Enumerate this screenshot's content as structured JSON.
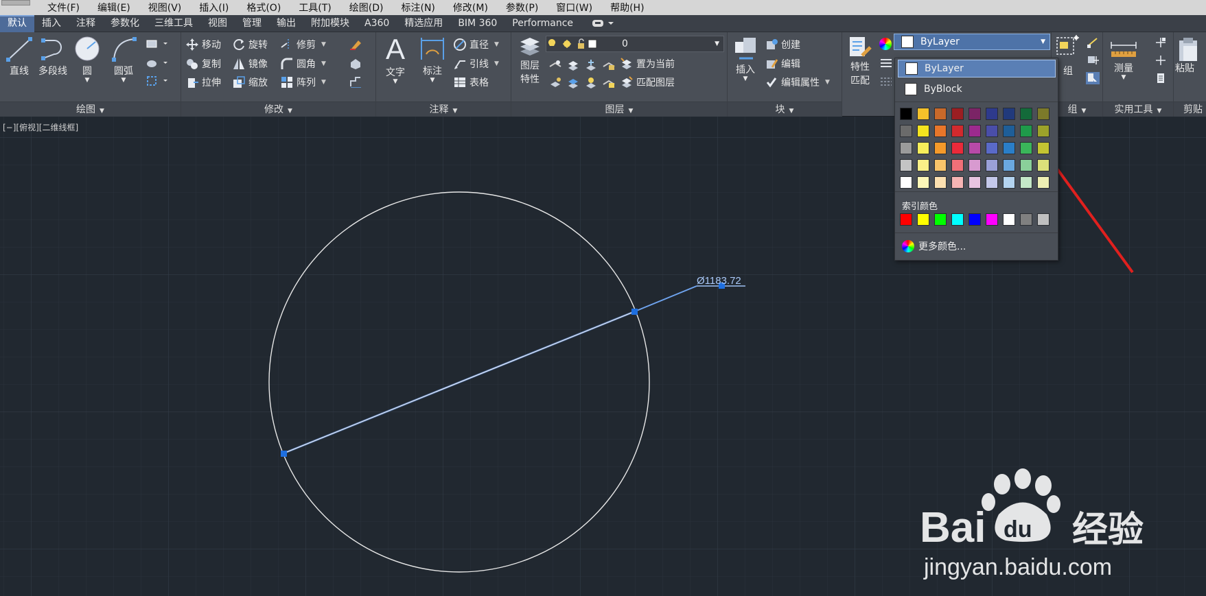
{
  "menubar": {
    "items": [
      "文件(F)",
      "编辑(E)",
      "视图(V)",
      "插入(I)",
      "格式(O)",
      "工具(T)",
      "绘图(D)",
      "标注(N)",
      "修改(M)",
      "参数(P)",
      "窗口(W)",
      "帮助(H)"
    ]
  },
  "tabs": [
    "默认",
    "插入",
    "注释",
    "参数化",
    "三维工具",
    "视图",
    "管理",
    "输出",
    "附加模块",
    "A360",
    "精选应用",
    "BIM 360",
    "Performance"
  ],
  "ribbon": {
    "draw": {
      "title": "绘图",
      "line": "直线",
      "polyline": "多段线",
      "circle": "圆",
      "arc": "圆弧"
    },
    "modify": {
      "title": "修改",
      "move": "移动",
      "rotate": "旋转",
      "trim": "修剪",
      "copy": "复制",
      "mirror": "镜像",
      "fillet": "圆角",
      "stretch": "拉伸",
      "scale": "缩放",
      "array": "阵列"
    },
    "annotation": {
      "title": "注释",
      "text": "文字",
      "dimension": "标注",
      "diameter": "直径",
      "leader": "引线",
      "table": "表格"
    },
    "layers": {
      "title": "图层",
      "properties_line1": "图层",
      "properties_line2": "特性",
      "current_layer": "0",
      "set_current": "置为当前",
      "match_layer": "匹配图层"
    },
    "block": {
      "title": "块",
      "insert": "插入",
      "create": "创建",
      "edit": "编辑",
      "edit_attributes": "编辑属性"
    },
    "properties": {
      "match_line1": "特性",
      "match_line2": "匹配",
      "color_value": "ByLayer"
    },
    "groups": {
      "title": "组",
      "group": "组"
    },
    "utilities": {
      "title": "实用工具",
      "measure": "测量"
    },
    "clipboard": {
      "title": "剪贴",
      "paste": "粘贴"
    }
  },
  "viewport": {
    "label": "[−][俯视][二维线框]",
    "dimension_text": "Ø1183.72"
  },
  "color_dropdown": {
    "options": [
      "ByLayer",
      "ByBlock"
    ],
    "selected": "ByLayer",
    "standard_colors": [
      [
        "#000000",
        "#f4c12a",
        "#c8692a",
        "#9b1e22",
        "#7b2466",
        "#2e3a8c",
        "#213a7c",
        "#136a3a",
        "#7c7a2a"
      ],
      [
        "#6b6b6b",
        "#f4e31f",
        "#e8762a",
        "#d12a2e",
        "#9c2a8e",
        "#4a4ea8",
        "#1e5e98",
        "#1f9a4a",
        "#9ca22a"
      ],
      [
        "#9b9b9b",
        "#f8ee5a",
        "#f59a2a",
        "#ea2a3a",
        "#b84aa8",
        "#5a6ac8",
        "#2a7ec8",
        "#3ab65a",
        "#c4c432"
      ],
      [
        "#c4c4c4",
        "#faf088",
        "#f8c46a",
        "#f07078",
        "#d89ad0",
        "#9aa0d8",
        "#6aa8e0",
        "#8ad09a",
        "#dce07a"
      ],
      [
        "#ffffff",
        "#fdf7b8",
        "#fce0b0",
        "#f6b4b4",
        "#e8c4e0",
        "#c4c8ea",
        "#b4d4f0",
        "#c4e8c8",
        "#eef0b4"
      ]
    ],
    "index_label": "索引颜色",
    "index_colors": [
      "#ff0000",
      "#ffff00",
      "#00ff00",
      "#00ffff",
      "#0000ff",
      "#ff00ff",
      "#ffffff",
      "#808080",
      "#c0c0c0"
    ],
    "more_colors": "更多颜色..."
  },
  "watermark": {
    "brand": "Bai",
    "brand_paw": "du",
    "brand_cn": "经验",
    "url": "jingyan.baidu.com"
  },
  "colors": {
    "canvas": "#212830",
    "ribbon": "#4a4f57",
    "accent": "#4e73a8",
    "grip": "#1e6fe0",
    "annotation_arrow": "#e0201e"
  }
}
